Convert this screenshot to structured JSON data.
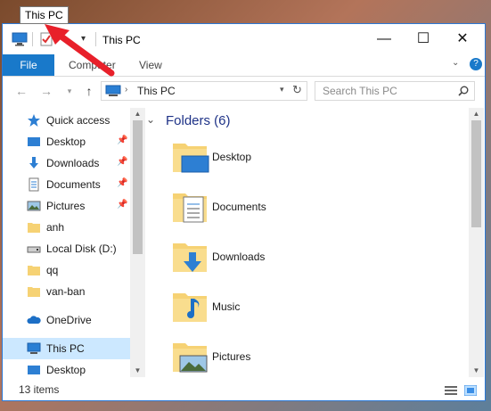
{
  "tooltip": "This PC",
  "window": {
    "title": "This PC",
    "controls": {
      "minimize": "—",
      "maximize": "☐",
      "close": "✕"
    }
  },
  "ribbon": {
    "tabs": [
      "File",
      "Computer",
      "View"
    ]
  },
  "address": {
    "path": "This PC",
    "search_placeholder": "Search This PC"
  },
  "nav_pane": {
    "items": [
      {
        "label": "Quick access",
        "icon": "star-icon"
      },
      {
        "label": "Desktop",
        "icon": "desktop-icon",
        "pinned": true
      },
      {
        "label": "Downloads",
        "icon": "download-icon",
        "pinned": true
      },
      {
        "label": "Documents",
        "icon": "documents-icon",
        "pinned": true
      },
      {
        "label": "Pictures",
        "icon": "pictures-icon",
        "pinned": true
      },
      {
        "label": "anh",
        "icon": "folder-icon"
      },
      {
        "label": "Local Disk (D:)",
        "icon": "drive-icon"
      },
      {
        "label": "qq",
        "icon": "folder-icon"
      },
      {
        "label": "van-ban",
        "icon": "folder-icon"
      },
      {
        "label": "OneDrive",
        "icon": "cloud-icon"
      },
      {
        "label": "This PC",
        "icon": "computer-icon",
        "selected": true
      },
      {
        "label": "Desktop",
        "icon": "desktop-icon"
      }
    ]
  },
  "content": {
    "group_title": "Folders (6)",
    "folders": [
      {
        "label": "Desktop",
        "overlay": "desktop"
      },
      {
        "label": "Documents",
        "overlay": "documents"
      },
      {
        "label": "Downloads",
        "overlay": "download"
      },
      {
        "label": "Music",
        "overlay": "music"
      },
      {
        "label": "Pictures",
        "overlay": "pictures"
      }
    ]
  },
  "status": {
    "items_count": "13 items"
  },
  "colors": {
    "accent": "#1979ca",
    "selected": "#cce8ff",
    "folder": "#f6d274",
    "annotation": "#e8202a"
  }
}
